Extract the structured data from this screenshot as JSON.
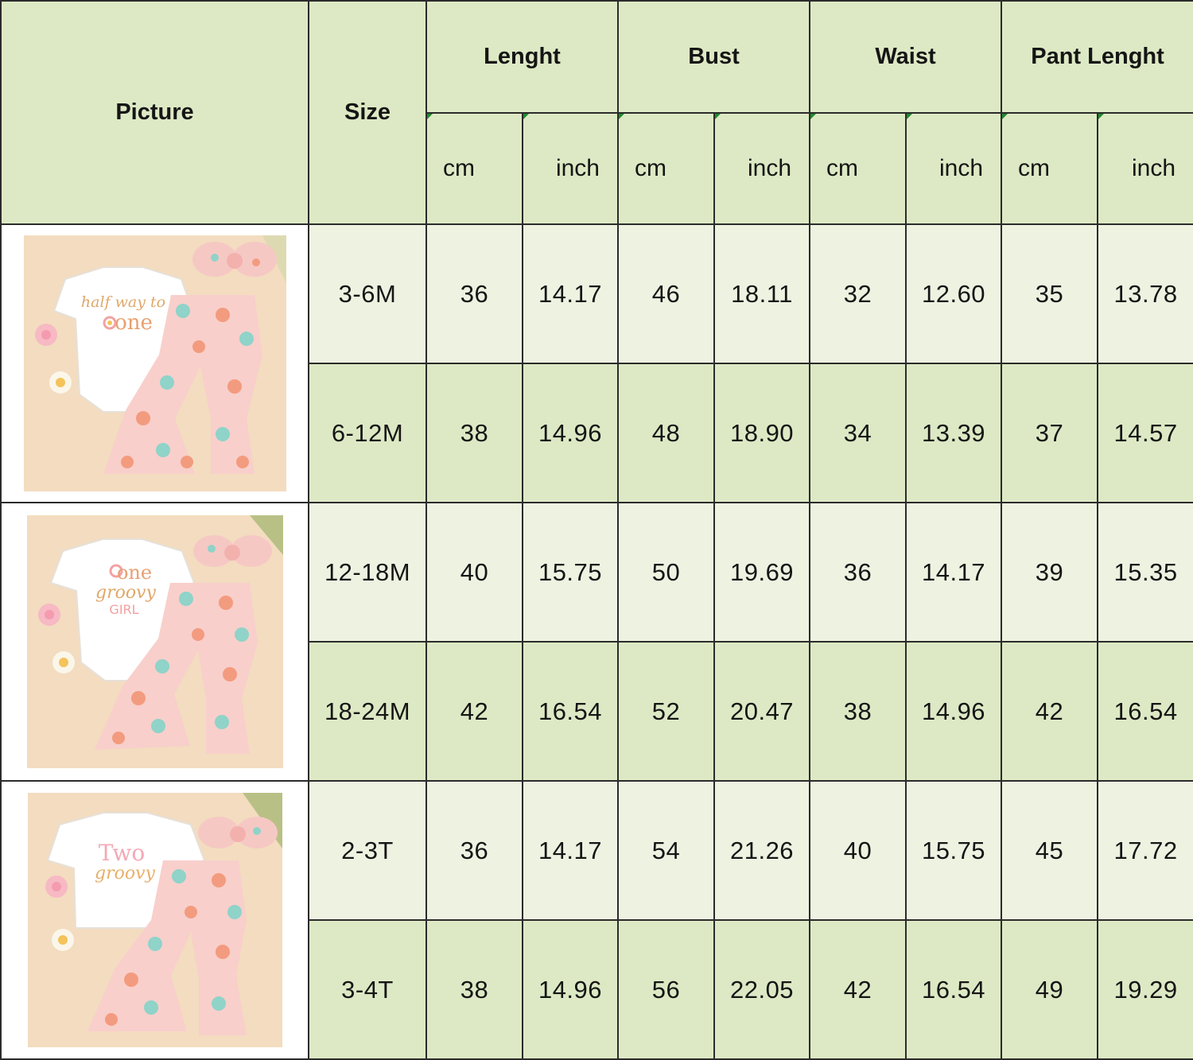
{
  "headers": {
    "picture": "Picture",
    "size": "Size",
    "groups": [
      "Lenght",
      "Bust",
      "Waist",
      "Pant Lenght"
    ],
    "units": [
      "cm",
      "inch",
      "cm",
      "inch",
      "cm",
      "inch",
      "cm",
      "inch"
    ]
  },
  "rows": [
    {
      "size": "3-6M",
      "values": [
        "36",
        "14.17",
        "46",
        "18.11",
        "32",
        "12.60",
        "35",
        "13.78"
      ]
    },
    {
      "size": "6-12M",
      "values": [
        "38",
        "14.96",
        "48",
        "18.90",
        "34",
        "13.39",
        "37",
        "14.57"
      ]
    },
    {
      "size": "12-18M",
      "values": [
        "40",
        "15.75",
        "50",
        "19.69",
        "36",
        "14.17",
        "39",
        "15.35"
      ]
    },
    {
      "size": "18-24M",
      "values": [
        "42",
        "16.54",
        "52",
        "20.47",
        "38",
        "14.96",
        "42",
        "16.54"
      ]
    },
    {
      "size": "2-3T",
      "values": [
        "36",
        "14.17",
        "54",
        "21.26",
        "40",
        "15.75",
        "45",
        "17.72"
      ]
    },
    {
      "size": "3-4T",
      "values": [
        "38",
        "14.96",
        "56",
        "22.05",
        "42",
        "16.54",
        "49",
        "19.29"
      ]
    }
  ],
  "pictures": [
    {
      "line1": "half way to",
      "line2": "one"
    },
    {
      "line1": "one",
      "line2": "groovy",
      "line3": "GIRL"
    },
    {
      "line1": "Two",
      "line2": "groovy"
    }
  ],
  "colors": {
    "header": "#dde9c4",
    "row_light": "#eef2e1",
    "row_dark": "#dde9c4",
    "border": "#2b2b2b"
  }
}
